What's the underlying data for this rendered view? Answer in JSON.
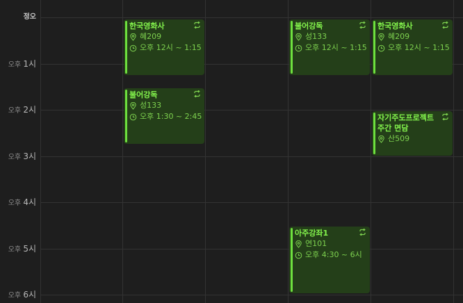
{
  "time_labels": {
    "noon": "정오",
    "h1": {
      "period": "오후",
      "hour": "1시"
    },
    "h2": {
      "period": "오후",
      "hour": "2시"
    },
    "h3": {
      "period": "오후",
      "hour": "3시"
    },
    "h4": {
      "period": "오후",
      "hour": "4시"
    },
    "h5": {
      "period": "오후",
      "hour": "5시"
    },
    "h6": {
      "period": "오후",
      "hour": "6시"
    }
  },
  "events": {
    "e1": {
      "title": "한국영화사",
      "location": "혜209",
      "time": "오후 12시 ~ 1:15",
      "icon": "repeat-icon"
    },
    "e2": {
      "title": "불어강독",
      "location": "성133",
      "time": "오후 1:30 ~ 2:45",
      "icon": "repeat-icon"
    },
    "e3": {
      "title": "불어강독",
      "location": "성133",
      "time": "오후 12시 ~ 1:15",
      "icon": "repeat-icon"
    },
    "e4": {
      "title": "아주강좌1",
      "location": "연101",
      "time": "오후 4:30 ~ 6시",
      "icon": "repeat-icon"
    },
    "e5": {
      "title": "한국영화사",
      "location": "혜209",
      "time": "오후 12시 ~ 1:15",
      "icon": "repeat-icon"
    },
    "e6": {
      "title": "자기주도프로젝트 주간 면담",
      "location": "산509",
      "icon": "repeat-icon"
    }
  },
  "colors": {
    "event_bg": "#243f19",
    "event_accent": "#6ee13e",
    "event_text": "#84f54d",
    "background": "#1e1e1e"
  }
}
